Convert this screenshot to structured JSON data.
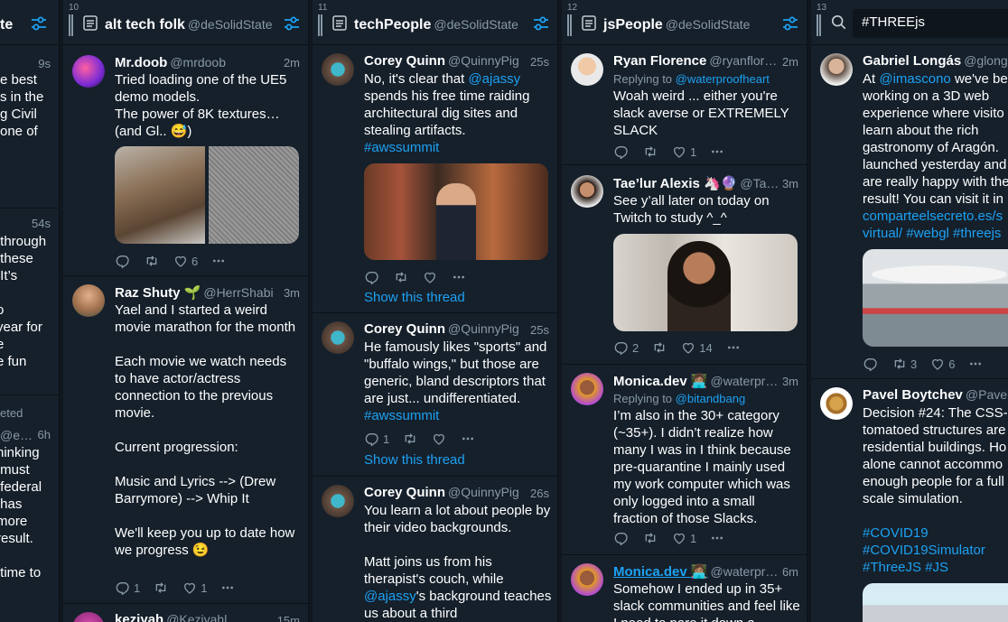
{
  "left_column": {
    "items": [
      {
        "time": "9s",
        "lines": "e best\ns in the\ng Civil\none of"
      },
      {
        "time": "54s",
        "lines": " through\n these\n It’s\n\no\nyear for\ne\ne fun"
      },
      {
        "time": "6h",
        "meta": "eted",
        "handle": "@e…",
        "lines": "hinking\n must\n federal\n has\nmore\nresult.\n\n time to"
      }
    ]
  },
  "columns": [
    {
      "num": "10",
      "title": "alt tech folk",
      "handle": "@deSolidState",
      "tweets": [
        {
          "name": "Mr.doob",
          "handle": "@mrdoob",
          "time": "2m",
          "text": "Tried loading one of the UE5 demo models.\nThe power of 8K textures… (and Gl.. 😅)",
          "likes": "6"
        },
        {
          "name": "Raz Shuty 🌱",
          "handle": "@HerrShabi",
          "time": "3m",
          "text": "Yael and I started a weird movie marathon for the month\n\nEach movie we watch needs to have actor/actress connection to the previous movie.\n\nCurrent progression:\n\nMusic and Lyrics --> (Drew Barrymore) --> Whip It\n\nWe'll keep you up to date how we progress 😉",
          "replies": "1",
          "likes": "1"
        },
        {
          "name": "keziyah",
          "handle": "@Keziyahl",
          "time": "15m"
        }
      ]
    },
    {
      "num": "11",
      "title": "techPeople",
      "handle": "@deSolidState",
      "tweets": [
        {
          "name": "Corey Quinn",
          "handle": "@QuinnyPig",
          "time": "25s",
          "text_a": "No, it's clear that ",
          "mention": "@ajassy",
          "text_b": " spends his free time raiding architectural dig sites and stealing artifacts.",
          "hashtag": "#awssummit",
          "thread": "Show this thread"
        },
        {
          "name": "Corey Quinn",
          "handle": "@QuinnyPig",
          "time": "25s",
          "text_a": "He famously likes \"sports\" and \"buffalo wings,\" but those are generic, bland descriptors that are just... undifferentiated. ",
          "hashtag": "#awssummit",
          "replies": "1",
          "thread": "Show this thread"
        },
        {
          "name": "Corey Quinn",
          "handle": "@QuinnyPig",
          "time": "26s",
          "text_a": "You learn a lot about people by their video backgrounds.\n\nMatt joins us from his therapist's couch, while ",
          "mention": "@ajassy",
          "text_b": "'s background teaches us about a third"
        }
      ]
    },
    {
      "num": "12",
      "title": "jsPeople",
      "handle": "@deSolidState",
      "tweets": [
        {
          "name": "Ryan Florence",
          "handle": "@ryanflor…",
          "time": "2m",
          "replying_label": "Replying to ",
          "replying_to": "@waterproofheart",
          "text": "Woah weird ... either you're slack averse or EXTREMELY SLACK",
          "likes": "1"
        },
        {
          "name": "Tae’lur Alexis 🦄🔮",
          "handle": "@Ta…",
          "time": "3m",
          "text": "See y’all later on today on Twitch to study ^_^",
          "replies": "2",
          "likes": "14"
        },
        {
          "name": "Monica.dev 👩🏽‍💻",
          "handle": "@waterpr…",
          "time": "3m",
          "replying_label": "Replying to ",
          "replying_to": "@bitandbang",
          "text": "I’m also in the 30+ category (~35+). I didn’t realize how many I was in I think because pre-quarantine I mainly used my work computer which was only logged into a small fraction of those Slacks.",
          "likes": "1"
        },
        {
          "name": "Monica.dev 👩🏽‍💻",
          "handle": "@waterpr…",
          "time": "6m",
          "text": "Somehow I ended up in 35+ slack communities and feel like I need to pare it down a"
        }
      ]
    },
    {
      "num": "13",
      "search_value": "#THREEjs",
      "tweets": [
        {
          "name": "Gabriel Longás",
          "handle": "@glong…",
          "text_a": "At ",
          "mention": "@imascono",
          "text_b": " we've be working on a 3D web experience where visito learn about the rich gastronomy of Aragón. launched yesterday and are really happy with the result! You can visit it in ",
          "url": "comparteelsecreto.es/s virtual/",
          "hashtags": "#webgl #threejs",
          "retweets": "3",
          "likes": "6"
        },
        {
          "name": "Pavel Boytchev",
          "handle": "@Pavel…",
          "text": "Decision #24: The CSS- tomatoed structures are residential buildings. Ho alone cannot accommo enough people for a full scale simulation.",
          "hashtags": "#COVID19\n#COVID19Simulator\n#ThreeJS #JS"
        }
      ]
    }
  ]
}
